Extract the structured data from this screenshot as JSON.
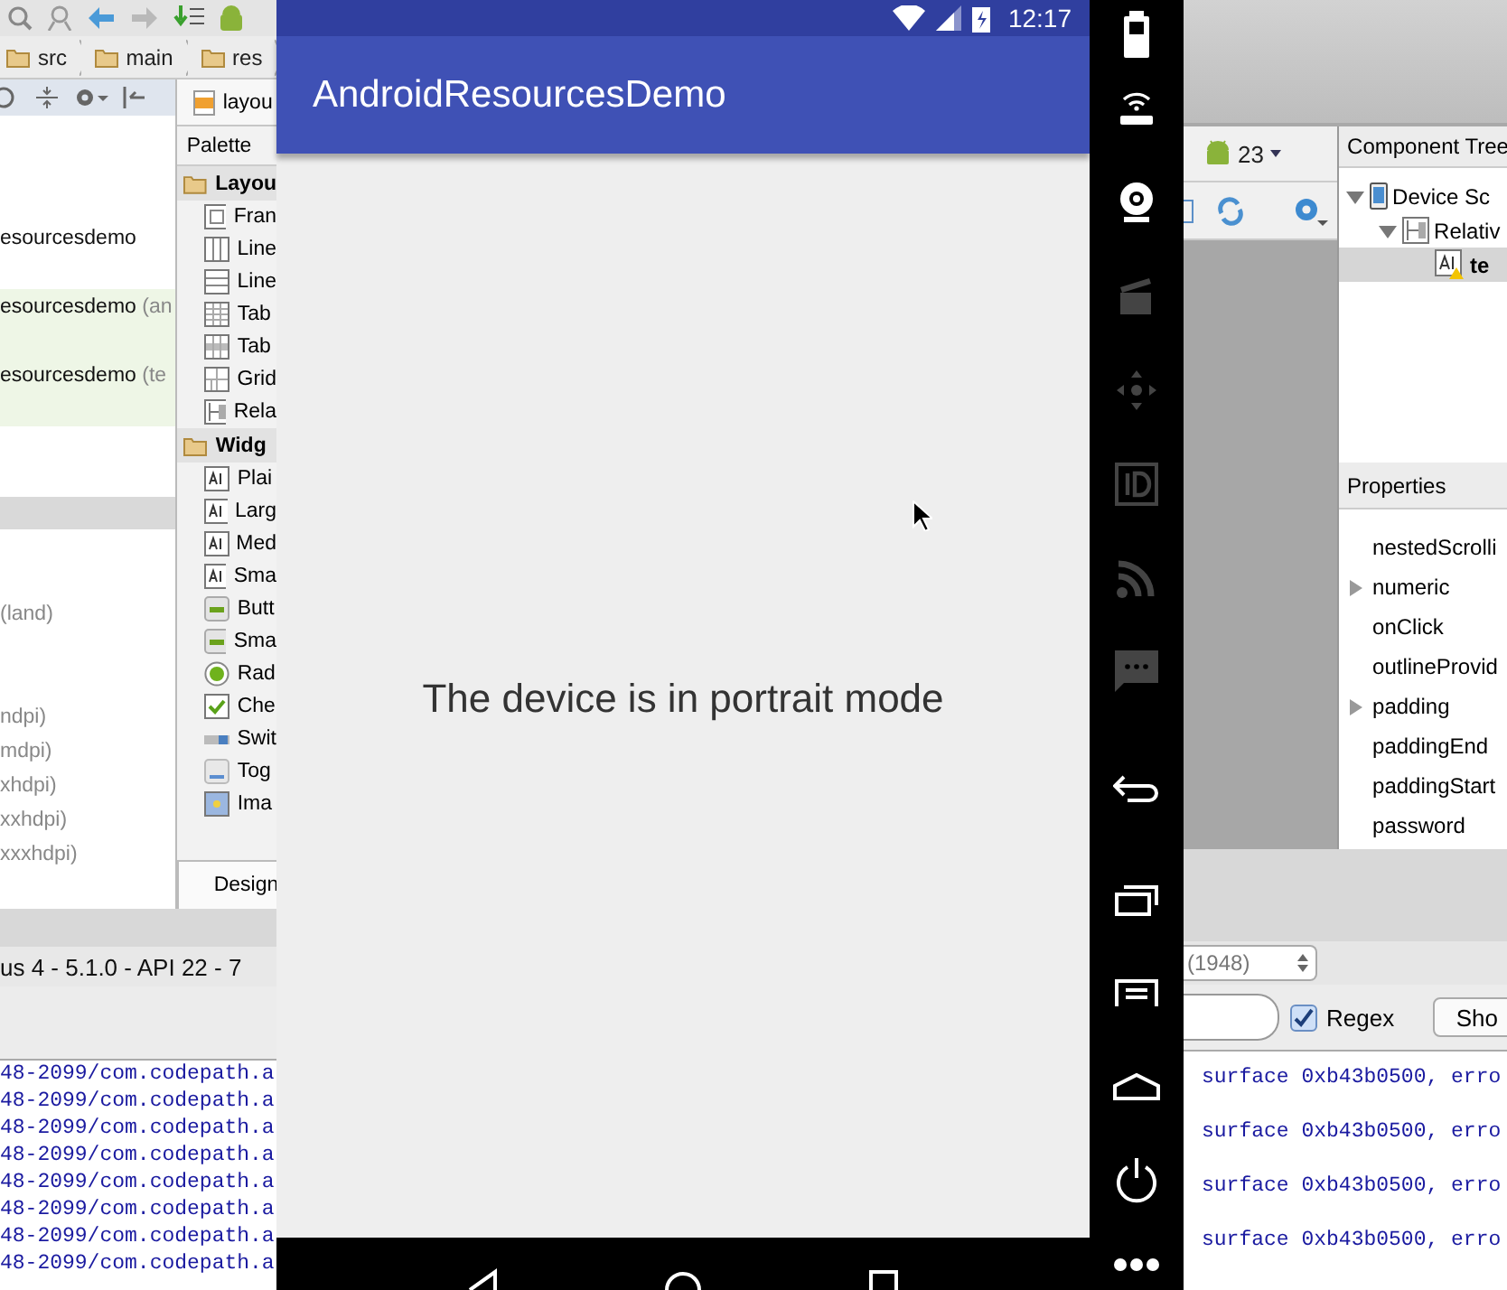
{
  "breadcrumb": [
    "src",
    "main",
    "res"
  ],
  "editor_tab": "layou",
  "project_tree": {
    "modules": [
      {
        "name": "esourcesdemo",
        "highlighted": false
      },
      {
        "name": "esourcesdemo",
        "qualifier": "(an",
        "highlighted": true
      },
      {
        "name": "esourcesdemo",
        "qualifier": "(te",
        "highlighted": true
      }
    ],
    "layouts": [
      {
        "qualifier": "(land)"
      }
    ],
    "densities": [
      {
        "qualifier": "ndpi)"
      },
      {
        "qualifier": "mdpi)"
      },
      {
        "qualifier": "xhdpi)"
      },
      {
        "qualifier": "xxhdpi)"
      },
      {
        "qualifier": "xxxhdpi)"
      }
    ]
  },
  "palette": {
    "header": "Palette",
    "groups": [
      {
        "name": "Layou",
        "items": [
          {
            "label": "Fran",
            "kind": "frame"
          },
          {
            "label": "Line",
            "kind": "linear-v"
          },
          {
            "label": "Line",
            "kind": "linear-h"
          },
          {
            "label": "Tab",
            "kind": "table"
          },
          {
            "label": "Tab",
            "kind": "table-row"
          },
          {
            "label": "Grid",
            "kind": "grid"
          },
          {
            "label": "Rela",
            "kind": "relative"
          }
        ]
      },
      {
        "name": "Widg",
        "items": [
          {
            "label": "Plai",
            "kind": "text"
          },
          {
            "label": "Larg",
            "kind": "text"
          },
          {
            "label": "Med",
            "kind": "text"
          },
          {
            "label": "Sma",
            "kind": "text"
          },
          {
            "label": "Butt",
            "kind": "button"
          },
          {
            "label": "Sma",
            "kind": "button"
          },
          {
            "label": "Rad",
            "kind": "radio"
          },
          {
            "label": "Che",
            "kind": "checkbox"
          },
          {
            "label": "Swit",
            "kind": "switch"
          },
          {
            "label": "Tog",
            "kind": "toggle"
          },
          {
            "label": "Ima",
            "kind": "image"
          }
        ]
      }
    ]
  },
  "design_tab": "Design",
  "device_bar": "us 4 - 5.1.0 - API 22 - 7",
  "log_left": [
    "48-2099/com.codepath.a",
    "48-2099/com.codepath.a",
    "48-2099/com.codepath.a",
    "48-2099/com.codepath.a",
    "48-2099/com.codepath.a",
    "48-2099/com.codepath.a",
    "48-2099/com.codepath.a",
    "48-2099/com.codepath.a"
  ],
  "emulator": {
    "time": "12:17",
    "app_title": "AndroidResourcesDemo",
    "message": "The device is in portrait mode"
  },
  "api_level": "23",
  "component_tree": {
    "header": "Component Tree",
    "items": [
      {
        "label": "Device Sc",
        "kind": "device",
        "expanded": true,
        "selected": false,
        "children": [
          {
            "label": "Relativ",
            "kind": "layout",
            "expanded": true,
            "selected": false,
            "children": [
              {
                "label": "te",
                "kind": "text",
                "selected": true,
                "warning": true
              }
            ]
          }
        ]
      }
    ]
  },
  "properties": {
    "header": "Properties",
    "items": [
      {
        "name": "nestedScrolli",
        "expandable": false
      },
      {
        "name": "numeric",
        "expandable": true
      },
      {
        "name": "onClick",
        "expandable": false
      },
      {
        "name": "outlineProvid",
        "expandable": false
      },
      {
        "name": "padding",
        "expandable": true
      },
      {
        "name": "paddingEnd",
        "expandable": false
      },
      {
        "name": "paddingStart",
        "expandable": false
      },
      {
        "name": "password",
        "expandable": false
      }
    ]
  },
  "log_filter": {
    "process": "(1948)",
    "regex": {
      "label": "Regex",
      "checked": true
    },
    "button": "Sho"
  },
  "log_right": [
    "surface 0xb43b0500, erro",
    "surface 0xb43b0500, erro",
    "surface 0xb43b0500, erro",
    "surface 0xb43b0500, erro"
  ]
}
